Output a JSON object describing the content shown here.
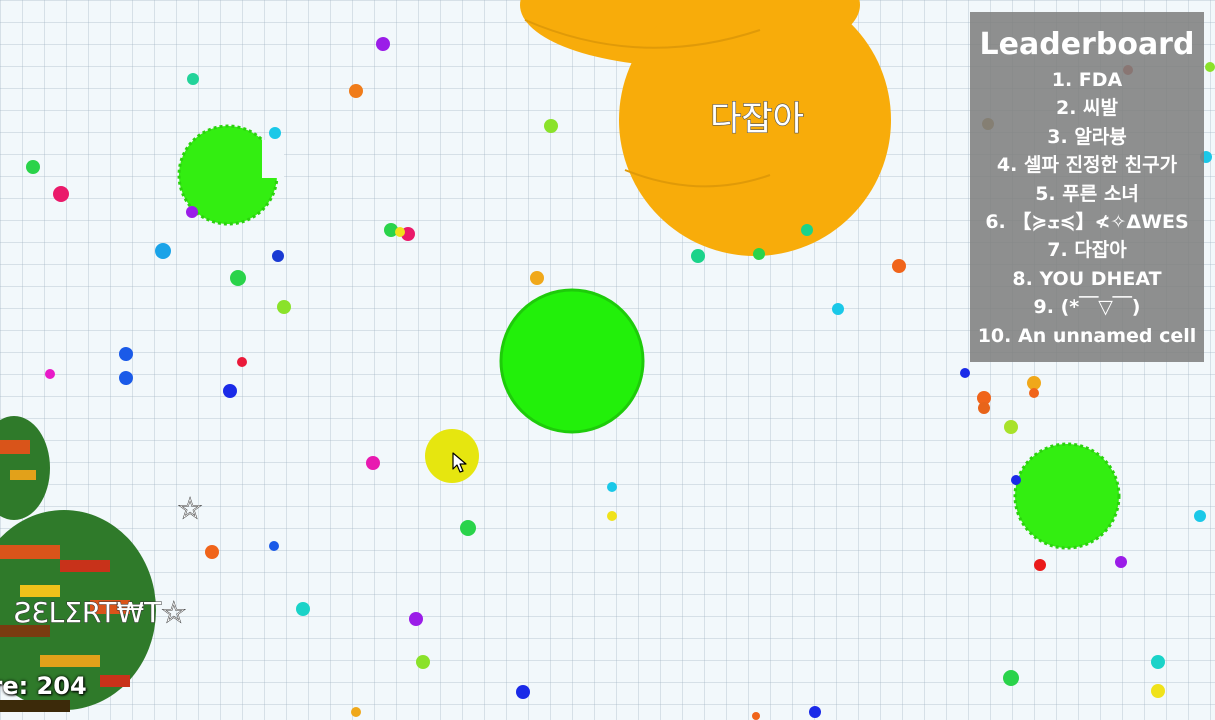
{
  "leaderboard": {
    "title": "Leaderboard",
    "entries": [
      {
        "rank": "1.",
        "name": "FDA"
      },
      {
        "rank": "2.",
        "name": "씨발"
      },
      {
        "rank": "3.",
        "name": "알라븅"
      },
      {
        "rank": "4.",
        "name": "셀파 진정한 친구가"
      },
      {
        "rank": "5.",
        "name": "푸른 소녀"
      },
      {
        "rank": "6.",
        "name": "【≽ܫ≼】≮✧ΔWES"
      },
      {
        "rank": "7.",
        "name": "다잡아"
      },
      {
        "rank": "8.",
        "name": "YOU DHEAT"
      },
      {
        "rank": "9.",
        "name": "(*￣▽￣)"
      },
      {
        "rank": "10.",
        "name": "An unnamed cell"
      }
    ]
  },
  "cells": {
    "orange_name": "다잡아",
    "bottom_left_name": "ƧƐLΣRT₩T☆",
    "bottom_left_name_top": "☆"
  },
  "hud": {
    "score_text": "ore: 204"
  },
  "colors": {
    "background": "#f2f8fb",
    "grid": "#a0b4c3",
    "orange_cell": "#f8ac0a",
    "green_cell": "#33ee11",
    "green_cell_bright": "#22f00a",
    "yellow_cell": "#e6e60f",
    "camo_cell": "#2f7a2a",
    "leaderboard_bg": "#808080"
  },
  "icons": {
    "cursor": "mouse-pointer-icon"
  }
}
